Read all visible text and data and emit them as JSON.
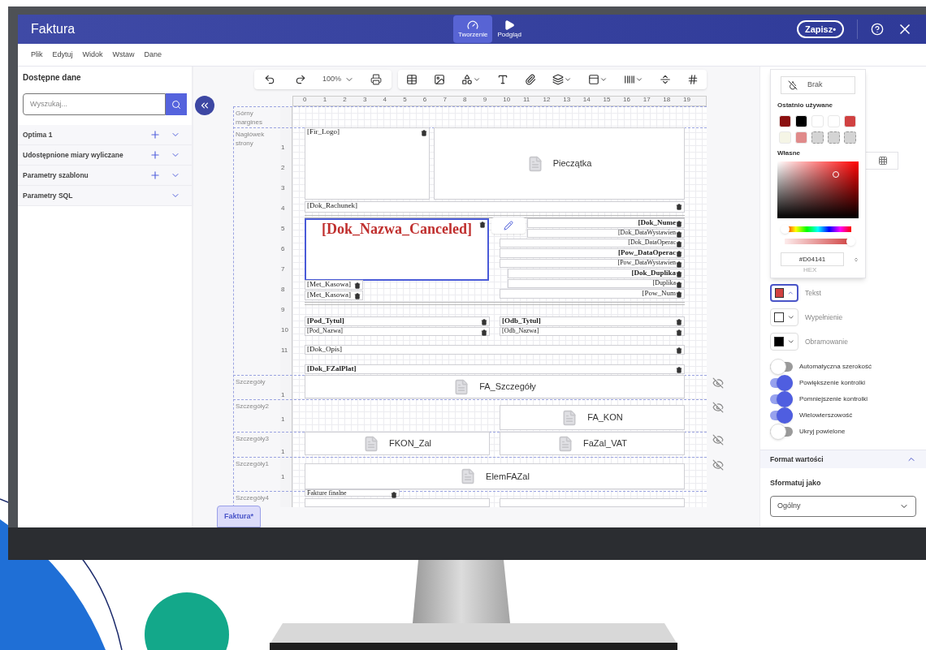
{
  "header": {
    "title": "Faktura",
    "modes": [
      {
        "label": "Tworzenie",
        "selected": true
      },
      {
        "label": "Podgląd",
        "selected": false
      }
    ],
    "save": "Zapisz•"
  },
  "menu": [
    "Plik",
    "Edytuj",
    "Widok",
    "Wstaw",
    "Dane"
  ],
  "sidebar": {
    "title": "Dostępne dane",
    "search": {
      "placeholder": "Wyszukaj..."
    },
    "sections": [
      {
        "label": "Optima 1",
        "can_add": true,
        "expanded": false
      },
      {
        "label": "Udostępnione miary wyliczane",
        "can_add": true,
        "expanded": false
      },
      {
        "label": "Parametry szablonu",
        "can_add": true,
        "expanded": false
      },
      {
        "label": "Parametry SQL",
        "can_add": false,
        "expanded": false
      }
    ]
  },
  "toolbar": {
    "zoom": "100%"
  },
  "designer": {
    "ruler": [
      "0",
      "1",
      "2",
      "3",
      "4",
      "5",
      "6",
      "7",
      "8",
      "9",
      "10",
      "11",
      "12",
      "13",
      "14",
      "15",
      "16",
      "17",
      "18",
      "19"
    ],
    "bands": [
      {
        "label": "Górny margines",
        "hideable": false
      },
      {
        "label": "Nagłówek strony",
        "ruler": [
          "1",
          "2",
          "3",
          "4",
          "5",
          "6",
          "7",
          "8",
          "9",
          "10",
          "11"
        ],
        "hideable": false
      },
      {
        "label": "Szczegóły",
        "ruler": [
          "1"
        ],
        "hideable": true
      },
      {
        "label": "Szczegóły2",
        "ruler": [
          "1"
        ],
        "hideable": true
      },
      {
        "label": "Szczegóły3",
        "ruler": [
          "1"
        ],
        "hideable": true
      },
      {
        "label": "Szczegóły1",
        "ruler": [
          "1"
        ],
        "hideable": true
      },
      {
        "label": "Szczegóły4",
        "hideable": false
      }
    ],
    "fields": [
      {
        "text": "[Fir_Logo]",
        "kind": "field",
        "bold": false
      },
      {
        "text": "Pieczątka",
        "kind": "subreport"
      },
      {
        "text": "[Dok_Rachunek]",
        "kind": "field",
        "bold": false
      },
      {
        "text": "[Dok_Nazwa_Canceled]",
        "kind": "title",
        "bold": true,
        "selected": true
      },
      {
        "text": "[Dok_Nume",
        "kind": "field-right",
        "bold": true
      },
      {
        "text": "[Dok_DataWystawien",
        "kind": "field-right",
        "bold": false
      },
      {
        "text": "[Dok_DataOperac",
        "kind": "field-right",
        "bold": false
      },
      {
        "text": "[Pow_DataOperac",
        "kind": "field-right",
        "bold": true
      },
      {
        "text": "[Pow_DataWystawien",
        "kind": "field-right",
        "bold": false
      },
      {
        "text": "[Dok_Duplika",
        "kind": "field-right",
        "bold": true
      },
      {
        "text": "[Duplika",
        "kind": "field-right",
        "bold": false
      },
      {
        "text": "[Pow_Num",
        "kind": "field-right",
        "bold": false
      },
      {
        "text": "[Met_Kasowa]",
        "kind": "field",
        "bold": false
      },
      {
        "text": "[Met_Kasowa]",
        "kind": "field",
        "bold": false
      },
      {
        "text": "[Pod_Tytul]",
        "kind": "field",
        "bold": true
      },
      {
        "text": "[Odb_Tytul]",
        "kind": "field",
        "bold": true
      },
      {
        "text": "[Pod_Nazwa]",
        "kind": "field",
        "bold": false
      },
      {
        "text": "[Odb_Nazwa]",
        "kind": "field",
        "bold": false
      },
      {
        "text": "[Dok_Opis]",
        "kind": "field",
        "bold": false
      },
      {
        "text": "[Dok_FZalPlat]",
        "kind": "field",
        "bold": true
      },
      {
        "text": "FA_Szczegóły",
        "kind": "subreport"
      },
      {
        "text": "FA_KON",
        "kind": "subreport"
      },
      {
        "text": "FKON_Zal",
        "kind": "subreport"
      },
      {
        "text": "FaZal_VAT",
        "kind": "subreport"
      },
      {
        "text": "ElemFAZal",
        "kind": "subreport"
      },
      {
        "text": "Fakture finalne",
        "kind": "field",
        "bold": false
      }
    ]
  },
  "document_tab": {
    "label": "Faktura*",
    "selected": true
  },
  "color_picker": {
    "none": "Brak",
    "recent_title": "Ostatnio używane",
    "swatches": [
      {
        "kind": "color",
        "color": "#8b1010"
      },
      {
        "kind": "color",
        "color": "#000000"
      },
      {
        "kind": "color",
        "color": "#ffffff"
      },
      {
        "kind": "color",
        "color": "#ffffff"
      },
      {
        "kind": "color",
        "color": "#d04141"
      },
      {
        "kind": "color",
        "color": "#f5f5e6"
      },
      {
        "kind": "color",
        "color": "#e08a8a"
      },
      {
        "kind": "empty"
      },
      {
        "kind": "empty"
      },
      {
        "kind": "empty"
      }
    ],
    "custom_title": "Własne",
    "hue": {
      "level": 0
    },
    "alpha": {
      "level": 1
    },
    "hex": "#D04141",
    "hex_label": "HEX"
  },
  "properties": {
    "colors": [
      {
        "label": "Tekst",
        "color": "#d04141",
        "open": true
      },
      {
        "label": "Wypełnienie",
        "color": "#ffffff",
        "open": false
      },
      {
        "label": "Obramowanie",
        "color": "#000000",
        "open": false
      }
    ],
    "toggles": [
      {
        "label": "Automatyczna szerokość",
        "on": false
      },
      {
        "label": "Powiększenie kontrolki",
        "on": true
      },
      {
        "label": "Pomniejszenie kontrolki",
        "on": true
      },
      {
        "label": "Wielowierszowość",
        "on": true
      },
      {
        "label": "Ukryj powielone",
        "on": false
      }
    ],
    "format": {
      "title": "Format wartości",
      "expanded": true,
      "label": "Sformatuj jako",
      "value": "Ogólny"
    }
  }
}
